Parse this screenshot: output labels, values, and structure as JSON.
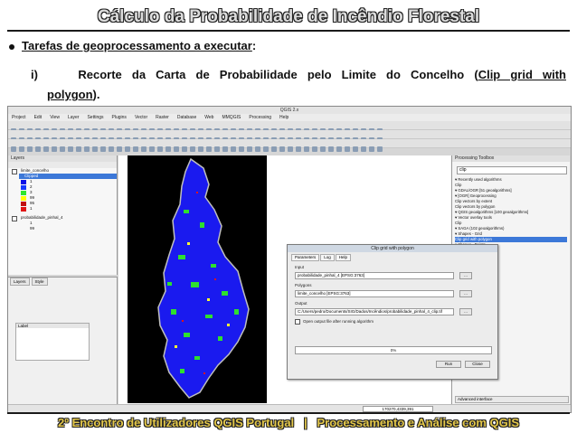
{
  "slide": {
    "title": "Cálculo da Probabilidade de Incêndio Florestal",
    "bullet_link": "Tarefas de geoprocessamento a executar",
    "bullet_colon": ":",
    "item_prefix": "i)",
    "item_text": "Recorte da Carta de Probabilidade pelo Limite do Concelho (",
    "item_link_a": "Clip grid with",
    "item_link_b": "polygon",
    "item_end": ").",
    "footer_left": "2º Encontro de Utilizadores QGIS Portugal",
    "footer_sep": "|",
    "footer_right": "Processamento e Análise com QGIS"
  },
  "qgis": {
    "window_title": "QGIS 2.x",
    "menus": [
      "Project",
      "Edit",
      "View",
      "Layer",
      "Settings",
      "Plugins",
      "Vector",
      "Raster",
      "Database",
      "Web",
      "MMQGIS",
      "Processing",
      "Help"
    ],
    "layers_panel_title": "Layers",
    "layers": [
      {
        "name": "limite_concelho",
        "checked": true
      },
      {
        "name": "Clipped",
        "selected": true,
        "checked": true
      }
    ],
    "legend_classes": [
      {
        "label": "1",
        "color": "#0a10e6"
      },
      {
        "label": "2",
        "color": "#1438ff"
      },
      {
        "label": "3",
        "color": "#2de62d"
      },
      {
        "label": "99",
        "color": "#ffff00"
      },
      {
        "label": "95",
        "color": "#c01010"
      },
      {
        "label": "1",
        "color": "#e01414"
      }
    ],
    "second_layer": "probabilidade_pinhal_4",
    "second_classes": [
      "1",
      "99"
    ],
    "style_panel_tabs": [
      "Layers",
      "Style"
    ],
    "style_list_header": "Label",
    "toolbox_title": "Processing Toolbox",
    "toolbox_search": "clip",
    "toolbox_tree": [
      "▾ Recently used algorithms",
      "   Clip",
      "▾ GDAL/OGR [51 geoalgorithms]",
      "  ▾ [OGR] Geoprocessing",
      "     Clip vectors by extent",
      "     Clip vectors by polygon",
      "▾ QGIS geoalgorithms [100 geoalgorithms]",
      "  ▾ Vector overlay tools",
      "     Clip",
      "▾ SAGA (102 geoalgorithms)",
      "  ▾ Shapes - Grid",
      "     Clip grid with polygon",
      "  ▾ Shapes - Points",
      "     Clip points with polygon"
    ],
    "toolbox_highlight_index": 11,
    "advanced_label": "Advanced interface",
    "status_coord": "170270,4339,391",
    "dialog": {
      "title": "Clip grid with polygon",
      "tabs": [
        "Parameters",
        "Log",
        "Help"
      ],
      "input_label": "Input",
      "input_value": "probabilidade_pinhal_4 [EPSG:3763]",
      "polygons_label": "Polygons",
      "polygons_value": "limite_concelho [EPSG:3763]",
      "output_label": "Output",
      "output_value": "C:/Users/pedro/Documents/SIG/Dados/Incêndios/probabilidade_pinhal_4_clip.tif",
      "open_output": "Open output file after running algorithm",
      "btn_browse": "...",
      "progress_pct": 0,
      "progress_text": "0%",
      "run_label": "Run",
      "close_label": "Close"
    }
  }
}
